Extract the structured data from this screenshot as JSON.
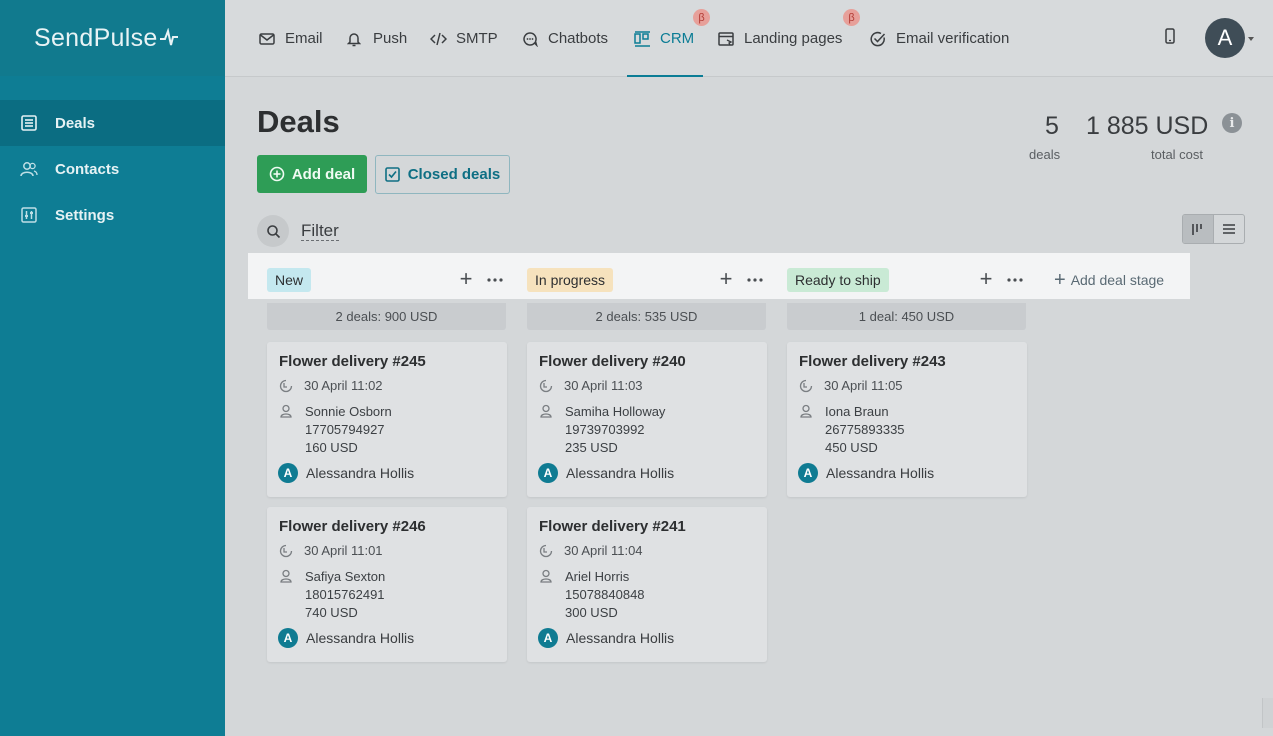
{
  "brand": {
    "name": "SendPulse"
  },
  "sidebar": {
    "items": [
      {
        "label": "Deals",
        "icon": "deals-icon",
        "active": true
      },
      {
        "label": "Contacts",
        "icon": "contacts-icon"
      },
      {
        "label": "Settings",
        "icon": "settings-icon"
      }
    ]
  },
  "topnav": {
    "items": [
      {
        "label": "Email",
        "icon": "envelope-icon"
      },
      {
        "label": "Push",
        "icon": "bell-icon"
      },
      {
        "label": "SMTP",
        "icon": "code-icon"
      },
      {
        "label": "Chatbots",
        "icon": "chat-icon"
      },
      {
        "label": "CRM",
        "icon": "crm-icon",
        "active": true,
        "beta": "β"
      },
      {
        "label": "Landing pages",
        "icon": "landing-icon",
        "beta": "β"
      },
      {
        "label": "Email verification",
        "icon": "check-circle-icon"
      }
    ],
    "avatar_letter": "A"
  },
  "page": {
    "title": "Deals",
    "add_deal": "Add deal",
    "closed_deals": "Closed deals",
    "stats": {
      "deals_count": "5",
      "deals_label": "deals",
      "total_cost": "1 885 USD",
      "total_label": "total cost"
    },
    "info": "i",
    "filter": "Filter"
  },
  "board": {
    "add_stage": "Add deal stage",
    "stages": [
      {
        "name": "New",
        "color": "#c4e8ef",
        "summary": "2 deals: 900 USD"
      },
      {
        "name": "In progress",
        "color": "#f6e2bd",
        "summary": "2 deals: 535 USD"
      },
      {
        "name": "Ready to ship",
        "color": "#c9ead5",
        "summary": "1 deal: 450 USD"
      }
    ],
    "cards": [
      {
        "title": "Flower delivery #245",
        "date": "30 April 11:02",
        "contact": "Sonnie Osborn",
        "phone": "17705794927",
        "amount": "160 USD",
        "owner": "Alessandra Hollis",
        "owner_initial": "A"
      },
      {
        "title": "Flower delivery #246",
        "date": "30 April 11:01",
        "contact": "Safiya Sexton",
        "phone": "18015762491",
        "amount": "740 USD",
        "owner": "Alessandra Hollis",
        "owner_initial": "A"
      },
      {
        "title": "Flower delivery #240",
        "date": "30 April 11:03",
        "contact": "Samiha Holloway",
        "phone": "19739703992",
        "amount": "235 USD",
        "owner": "Alessandra Hollis",
        "owner_initial": "A"
      },
      {
        "title": "Flower delivery #241",
        "date": "30 April 11:04",
        "contact": "Ariel Horris",
        "phone": "15078840848",
        "amount": "300 USD",
        "owner": "Alessandra Hollis",
        "owner_initial": "A"
      },
      {
        "title": "Flower delivery #243",
        "date": "30 April 11:05",
        "contact": "Iona Braun",
        "phone": "26775893335",
        "amount": "450 USD",
        "owner": "Alessandra Hollis",
        "owner_initial": "A"
      }
    ]
  }
}
